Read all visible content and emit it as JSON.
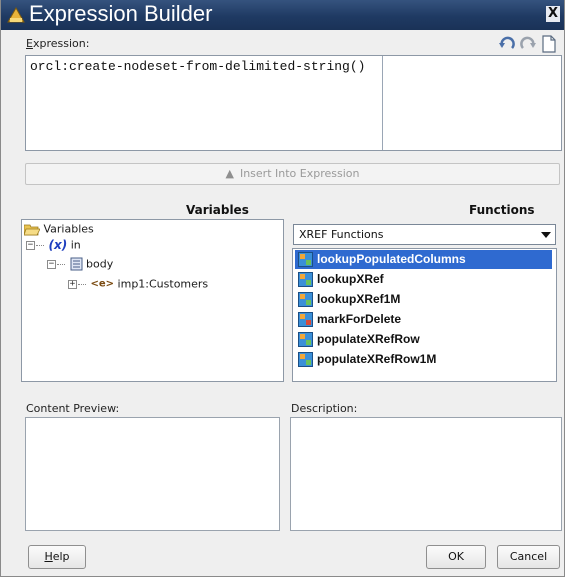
{
  "window": {
    "title": "Expression Builder",
    "close_label": "X"
  },
  "expression": {
    "label_underlined": "E",
    "label_rest": "xpression:",
    "value": "orcl:create-nodeset-from-delimited-string()",
    "toolbar_icons": [
      "undo-icon",
      "redo-icon",
      "new-document-icon"
    ]
  },
  "insert_button": {
    "label": "Insert Into Expression",
    "enabled": false
  },
  "variables": {
    "header": "Variables",
    "tree": [
      {
        "label": "Variables",
        "icon": "folder-open-icon",
        "level": 0
      },
      {
        "prefix": "(x)",
        "label": "in",
        "icon": "variable-icon",
        "level": 1,
        "expanded": true
      },
      {
        "label": "body",
        "icon": "message-part-icon",
        "level": 2,
        "expanded": true
      },
      {
        "prefix": "<e>",
        "label": "imp1:Customers",
        "icon": "element-icon",
        "level": 3,
        "expanded": false
      }
    ]
  },
  "functions": {
    "header": "Functions",
    "category": "XREF Functions",
    "items": [
      {
        "label": "lookupPopulatedColumns",
        "selected": true
      },
      {
        "label": "lookupXRef",
        "selected": false
      },
      {
        "label": "lookupXRef1M",
        "selected": false
      },
      {
        "label": "markForDelete",
        "selected": false
      },
      {
        "label": "populateXRefRow",
        "selected": false
      },
      {
        "label": "populateXRefRow1M",
        "selected": false
      }
    ]
  },
  "content_preview": {
    "label": "Content Preview:"
  },
  "description": {
    "label": "Description:"
  },
  "buttons": {
    "help_underlined": "H",
    "help_rest": "elp",
    "ok": "OK",
    "cancel": "Cancel"
  },
  "colors": {
    "title_bar": "#1f3a63",
    "selection": "#2f6ad0",
    "panel_border": "#8d98a6"
  }
}
